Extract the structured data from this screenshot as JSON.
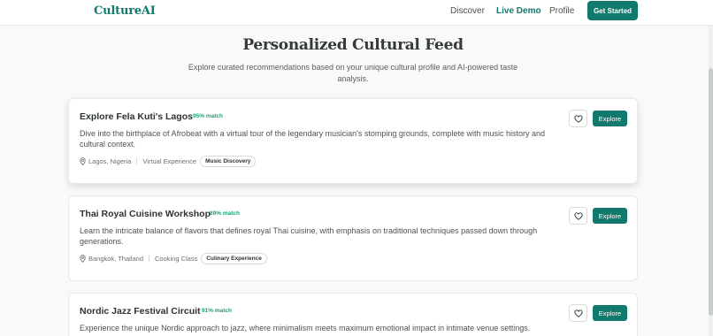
{
  "nav": {
    "logo": "CultureAI",
    "links": [
      {
        "label": "Discover"
      },
      {
        "label": "Live Demo"
      },
      {
        "label": "Profile"
      }
    ],
    "cta_label": "Get Started"
  },
  "feed": {
    "title": "Personalized Cultural Feed",
    "subtitle": "Explore curated recommendations based on your unique cultural profile and AI-powered taste analysis."
  },
  "cards": [
    {
      "title": "Explore Fela Kuti's Lagos",
      "match": "95% match",
      "description": "Dive into the birthplace of Afrobeat with a virtual tour of the legendary musician's stomping grounds, complete with music history and cultural context.",
      "location": "Lagos, Nigeria",
      "type": "Virtual Experience",
      "category": "Music Discovery",
      "action_label": "Explore"
    },
    {
      "title": "Thai Royal Cuisine Workshop",
      "match": "89% match",
      "description": "Learn the intricate balance of flavors that defines royal Thai cuisine, with emphasis on traditional techniques passed down through generations.",
      "location": "Bangkok, Thailand",
      "type": "Cooking Class",
      "category": "Culinary Experience",
      "action_label": "Explore"
    },
    {
      "title": "Nordic Jazz Festival Circuit",
      "match": "91% match",
      "description": "Experience the unique Nordic approach to jazz, where minimalism meets maximum emotional impact in intimate venue settings.",
      "action_label": "Explore"
    }
  ],
  "colors": {
    "brand": "#12796d",
    "match": "#19a37a",
    "background": "#f8f9f8"
  },
  "icons": {
    "location": "map-pin-icon",
    "favorite": "heart-icon"
  }
}
